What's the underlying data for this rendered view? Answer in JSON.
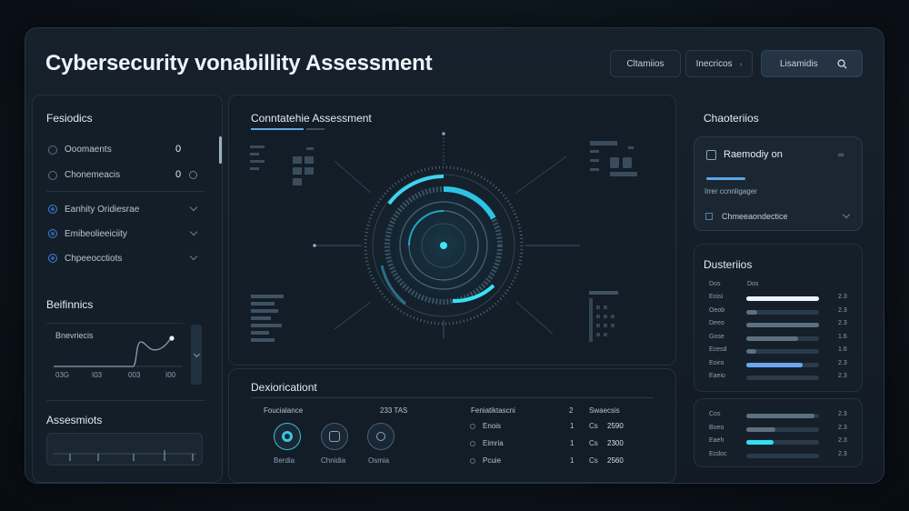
{
  "header": {
    "title": "Cybersecurity vonabillity Assessment",
    "btn_left": "Cltamiios",
    "btn_mid": "Inecricos",
    "search_label": "Lisamidis"
  },
  "left": {
    "section1_title": "Fesiodics",
    "items": [
      {
        "label": "Ooomaents",
        "value": "0"
      },
      {
        "label": "Chonemeacis",
        "value": "0"
      }
    ],
    "dropdowns": [
      {
        "label": "Eanhity Oridiesrae"
      },
      {
        "label": "Emibeolieeiciity"
      },
      {
        "label": "Chpeeocctiots"
      }
    ],
    "section2_title": "Beifinnics",
    "chart_label": "Bnevriecis",
    "chart_ticks": [
      "03G",
      "I03",
      "003",
      "I00"
    ],
    "section3_title": "Assesmiots"
  },
  "center": {
    "title": "Conntatehie Assessment",
    "bottom_title": "Dexioricationt",
    "col1_header": "Foucialance",
    "col1_value": "233 TAS",
    "circle_labels": [
      "Berdia",
      "Chnidia",
      "Osmia"
    ],
    "col2_header": "Feniatiktascni",
    "col2_header_num": "2",
    "col3_header": "Swaecsis",
    "rows": [
      {
        "label": "Enois",
        "num": "1",
        "tag": "Cs",
        "value": "2590"
      },
      {
        "label": "Eimria",
        "num": "1",
        "tag": "Cs",
        "value": "2300"
      },
      {
        "label": "Pcuie",
        "num": "1",
        "tag": "Cs",
        "value": "2560"
      }
    ]
  },
  "right": {
    "title": "Chaoteriios",
    "card_title": "Raemodiy on",
    "card_sub": "Irrer ccnnligager",
    "card_dropdown": "Chmeeaondectice",
    "dist_title": "Dusteriios",
    "dist_header": [
      "Dos",
      "Dos"
    ],
    "dist_rows": [
      {
        "label": "Eoisi",
        "value": "2.3",
        "fraction": 1.0
      },
      {
        "label": "Oeob",
        "value": "2.3",
        "fraction": 0.15
      },
      {
        "label": "Deeo",
        "value": "2.3",
        "fraction": 1.0
      },
      {
        "label": "Gose",
        "value": "1.6",
        "fraction": 0.71
      },
      {
        "label": "Ecesd",
        "value": "1.6",
        "fraction": 0.14
      },
      {
        "label": "Eoiro",
        "value": "2.3",
        "fraction": 0.78
      },
      {
        "label": "Eaeio",
        "value": "2.3",
        "fraction": 0.0
      }
    ],
    "bottom_rows": [
      {
        "label": "Cos",
        "value": "2.3",
        "fraction": 0.94
      },
      {
        "label": "Boeo",
        "value": "2.3",
        "fraction": 0.4
      },
      {
        "label": "Eaeh",
        "value": "2.3",
        "fraction": 0.38
      },
      {
        "label": "Ecdoc",
        "value": "2.3",
        "fraction": 0.0
      }
    ]
  },
  "colors": {
    "accent_cyan": "#2fe0f2",
    "accent_blue": "#6aa6f0",
    "bar_track": "#2a3b4b",
    "bar_gray": "#5c7080",
    "white_bar": "#eef3f7"
  }
}
